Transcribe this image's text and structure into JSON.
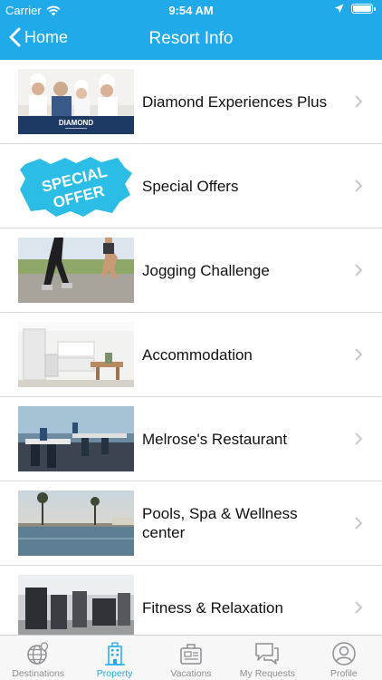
{
  "status": {
    "carrier": "Carrier",
    "time": "9:54 AM"
  },
  "nav": {
    "back_label": "Home",
    "title": "Resort Info"
  },
  "items": [
    {
      "label": "Diamond Experiences Plus",
      "thumb_logo": "DIAMOND"
    },
    {
      "label": "Special Offers",
      "thumb_text_1": "SPECIAL",
      "thumb_text_2": "OFFER"
    },
    {
      "label": "Jogging Challenge"
    },
    {
      "label": "Accommodation"
    },
    {
      "label": "Melrose's Restaurant"
    },
    {
      "label": "Pools, Spa & Wellness center"
    },
    {
      "label": "Fitness & Relaxation"
    }
  ],
  "tabs": [
    {
      "label": "Destinations",
      "icon": "globe-pin-icon"
    },
    {
      "label": "Property",
      "icon": "building-icon",
      "active": true
    },
    {
      "label": "Vacations",
      "icon": "suitcase-icon"
    },
    {
      "label": "My Requests",
      "icon": "chat-bubbles-icon"
    },
    {
      "label": "Profile",
      "icon": "person-icon"
    }
  ],
  "colors": {
    "accent": "#20aaea",
    "tab_inactive": "#8e8e93"
  }
}
